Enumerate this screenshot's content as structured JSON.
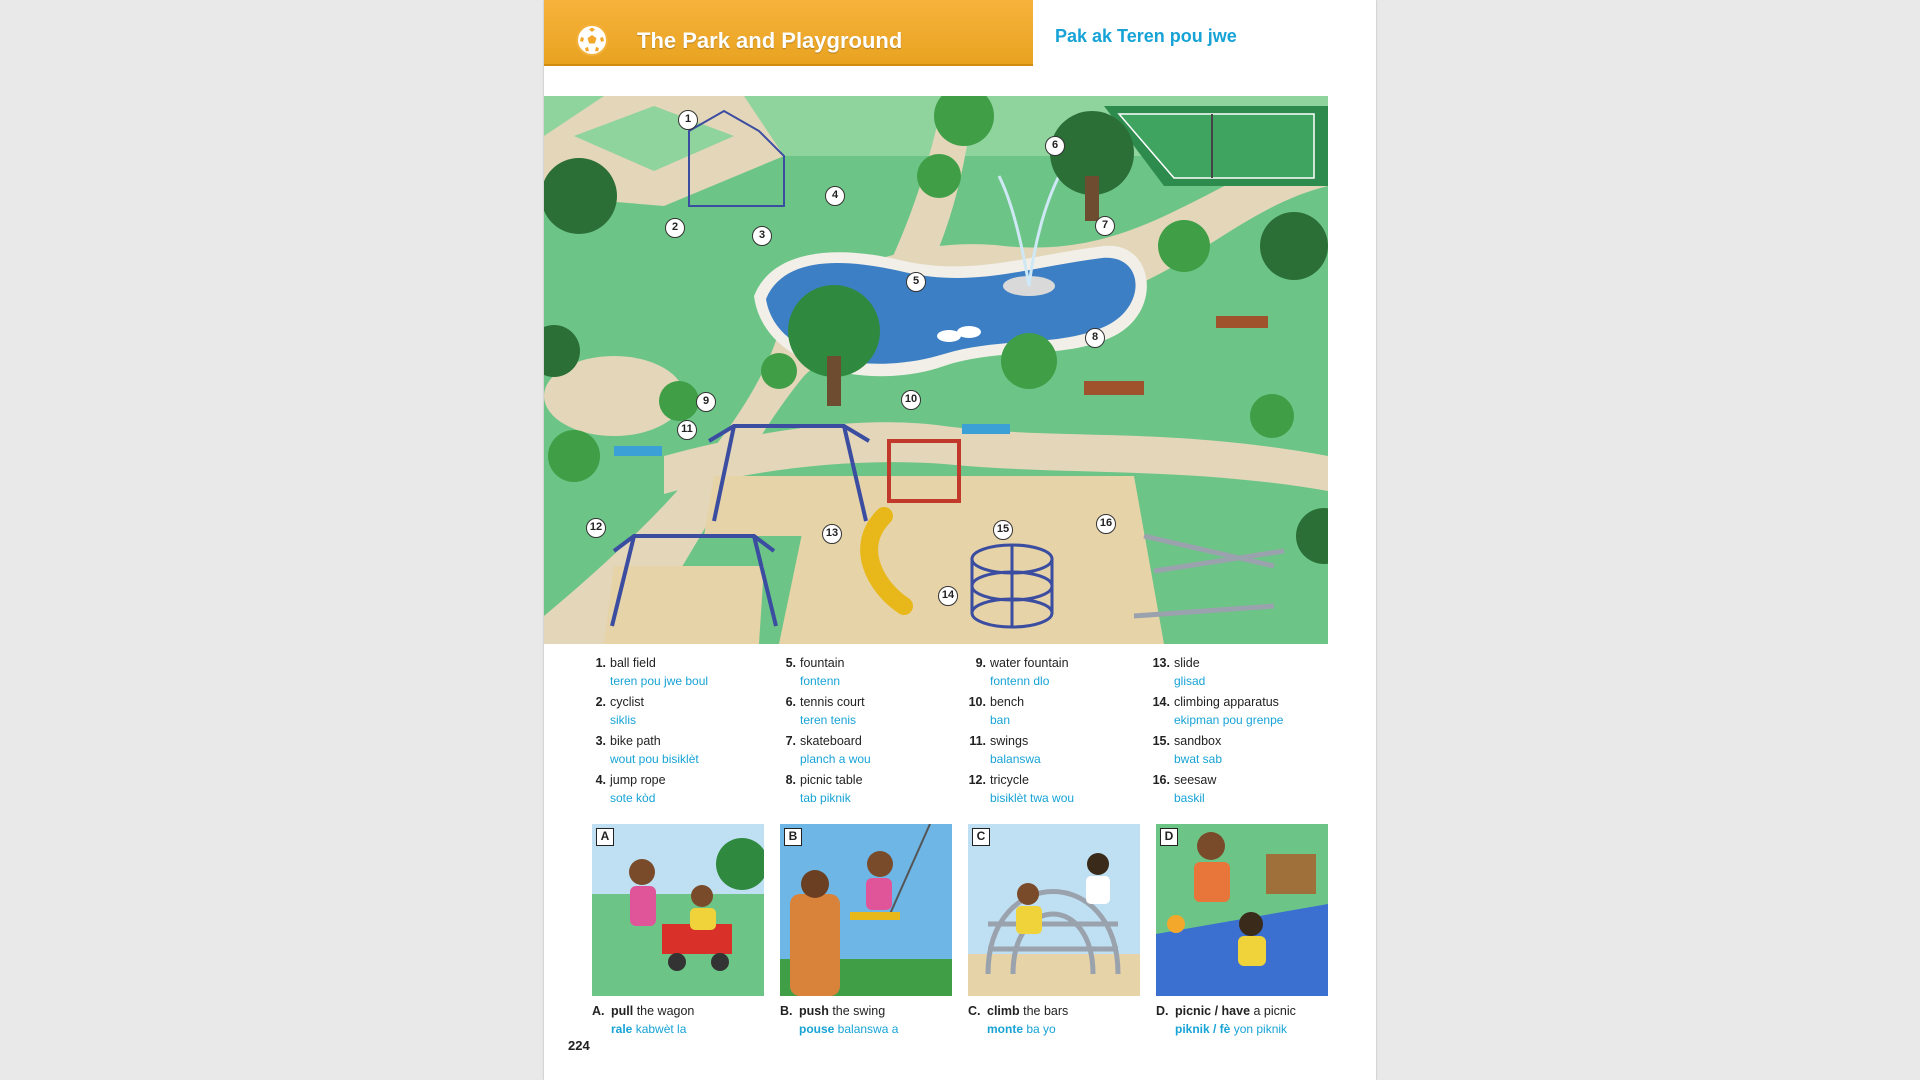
{
  "header": {
    "title_en": "The Park and Playground",
    "title_ht": "Pak ak Teren pou jwe"
  },
  "colors": {
    "header_orange": "#f3a82c",
    "translation_blue": "#17a3d6",
    "grass_green": "#6cc586",
    "path_beige": "#e3d6b9",
    "water_blue": "#3d7fc4"
  },
  "vocabulary": [
    {
      "num": "1.",
      "en": "ball field",
      "ht": "teren pou jwe boul"
    },
    {
      "num": "2.",
      "en": "cyclist",
      "ht": "siklis"
    },
    {
      "num": "3.",
      "en": "bike path",
      "ht": "wout pou bisiklèt"
    },
    {
      "num": "4.",
      "en": "jump rope",
      "ht": "sote kòd"
    },
    {
      "num": "5.",
      "en": "fountain",
      "ht": "fontenn"
    },
    {
      "num": "6.",
      "en": "tennis court",
      "ht": "teren tenis"
    },
    {
      "num": "7.",
      "en": "skateboard",
      "ht": "planch a wou"
    },
    {
      "num": "8.",
      "en": "picnic table",
      "ht": "tab piknik"
    },
    {
      "num": "9.",
      "en": "water fountain",
      "ht": "fontenn dlo"
    },
    {
      "num": "10.",
      "en": "bench",
      "ht": "ban"
    },
    {
      "num": "11.",
      "en": "swings",
      "ht": "balanswa"
    },
    {
      "num": "12.",
      "en": "tricycle",
      "ht": "bisiklèt twa wou"
    },
    {
      "num": "13.",
      "en": "slide",
      "ht": "glisad"
    },
    {
      "num": "14.",
      "en": "climbing apparatus",
      "ht": "ekipman pou grenpe"
    },
    {
      "num": "15.",
      "en": "sandbox",
      "ht": "bwat sab"
    },
    {
      "num": "16.",
      "en": "seesaw",
      "ht": "baskil"
    }
  ],
  "illustration_labels": [
    "1",
    "2",
    "3",
    "4",
    "5",
    "6",
    "7",
    "8",
    "9",
    "10",
    "11",
    "12",
    "13",
    "14",
    "15",
    "16"
  ],
  "actions": [
    {
      "letter": "A",
      "label": "A.",
      "verb": "pull",
      "rest": " the wagon",
      "verb_ht": "rale",
      "rest_ht": " kabwèt la"
    },
    {
      "letter": "B",
      "label": "B.",
      "verb": "push",
      "rest": " the swing",
      "verb_ht": "pouse",
      "rest_ht": " balanswa a"
    },
    {
      "letter": "C",
      "label": "C.",
      "verb": "climb",
      "rest": " the bars",
      "verb_ht": "monte",
      "rest_ht": " ba yo"
    },
    {
      "letter": "D",
      "label": "D.",
      "verb": "picnic / have",
      "rest": " a picnic",
      "verb_ht": "piknik / fè",
      "rest_ht": " yon piknik"
    }
  ],
  "page_number": "224"
}
